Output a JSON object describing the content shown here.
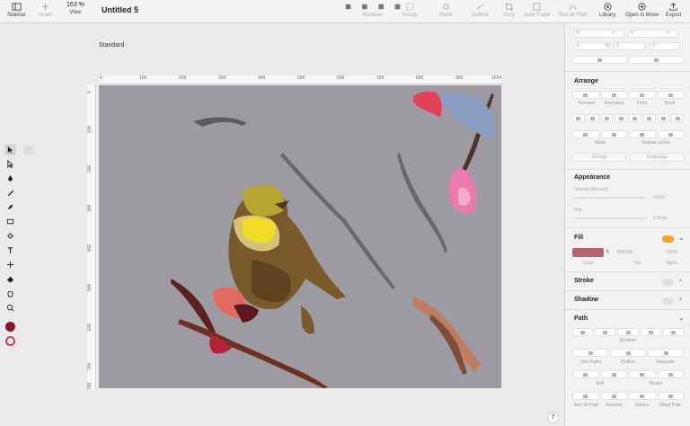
{
  "toolbar": {
    "sidebar": "Sidebar",
    "insert": "Insert",
    "zoom": "163 %",
    "view": "View",
    "title": "Untitled 5",
    "boolean": "Boolean",
    "group": "Group",
    "mask": "Mask",
    "outline": "Outline",
    "crop": "Crop",
    "auto_trace": "Auto Trace",
    "text_on_path": "Text on Path",
    "library": "Library",
    "open_in_move": "Open in Move",
    "export": "Export"
  },
  "canvas": {
    "artboard_label": "Standard",
    "ruler_top": [
      "0",
      "100",
      "200",
      "300",
      "400",
      "500",
      "600",
      "700",
      "800",
      "900",
      "1024"
    ],
    "ruler_left": [
      "0",
      "100",
      "200",
      "300",
      "400",
      "500",
      "600",
      "700",
      "768"
    ],
    "help": "?",
    "background_color": "#9d9aa1"
  },
  "inspector": {
    "geometry": {
      "x_label": "X",
      "x": "0",
      "y_label": "Y",
      "y": "0",
      "w_label": "W",
      "w": "0",
      "h_label": "H",
      "h": "0",
      "rotation": "0",
      "angle": "0 °"
    },
    "arrange": {
      "title": "Arrange",
      "order_labels": [
        "Forward",
        "Backward",
        "Front",
        "Back"
      ],
      "mask": "Mask",
      "repeat_action": "Repeat action",
      "group": "Group",
      "ungroup": "Ungroup"
    },
    "appearance": {
      "title": "Appearance",
      "opacity_label": "Opacity (Normal)",
      "opacity": "100%",
      "blur_label": "Blur",
      "blur": "0.00 pt"
    },
    "fill": {
      "title": "Fill",
      "color": "#b8636e",
      "hex": "B8636E",
      "alpha": "100%",
      "color_label": "Color",
      "hex_label": "Hex",
      "alpha_label": "Alpha",
      "toggle_color": "#f5a623"
    },
    "stroke": {
      "title": "Stroke"
    },
    "shadow": {
      "title": "Shadow"
    },
    "path": {
      "title": "Path",
      "boolean": "Boolean",
      "join_paths": "Join Paths",
      "outline": "Outline",
      "separate": "Separate",
      "edit": "Edit",
      "nodes": "Nodes",
      "text_on_path": "Text on Path",
      "reverse": "Reverse",
      "outline2": "Outline",
      "offset_path": "Offset Path"
    }
  }
}
